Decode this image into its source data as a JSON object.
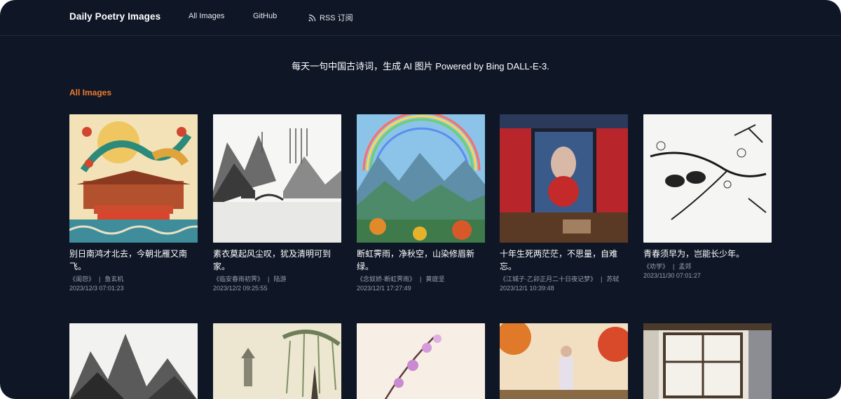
{
  "nav": {
    "brand": "Daily Poetry Images",
    "links": [
      {
        "label": "All Images"
      },
      {
        "label": "GitHub"
      },
      {
        "label": "RSS 订阅",
        "icon": "rss-icon"
      }
    ]
  },
  "tagline": "每天一句中国古诗词，生成 AI 图片 Powered by Bing DALL-E-3.",
  "section_title": "All Images",
  "cards": [
    {
      "title": "别日南鸿才北去，今朝北雁又南飞。",
      "source": "《闺怨》",
      "author": "鱼玄机",
      "date": "2023/12/3 07:01:23",
      "image": "dragon-temple-image"
    },
    {
      "title": "素衣莫起风尘叹，犹及清明可到家。",
      "source": "《临安春雨初霁》",
      "author": "陆游",
      "date": "2023/12/2 09:25:55",
      "image": "ink-landscape-bridge-image"
    },
    {
      "title": "断虹霁雨，净秋空，山染修眉新绿。",
      "source": "《念奴娇·断虹霁雨》",
      "author": "黄庭坚",
      "date": "2023/12/1 17:27:49",
      "image": "rainbow-mountains-image"
    },
    {
      "title": "十年生死两茫茫，不思量，自难忘。",
      "source": "《江城子·乙卯正月二十日夜记梦》",
      "author": "苏轼",
      "date": "2023/12/1 10:39:48",
      "image": "red-woman-room-image"
    },
    {
      "title": "青春须早为，岂能长少年。",
      "source": "《劝学》",
      "author": "孟郊",
      "date": "2023/11/30 07:01:27",
      "image": "birds-blossoms-ink-image"
    }
  ],
  "row2_images": [
    "ink-mountains-image",
    "willow-pagoda-image",
    "plum-blossom-image",
    "woman-autumn-image",
    "interior-window-image"
  ]
}
